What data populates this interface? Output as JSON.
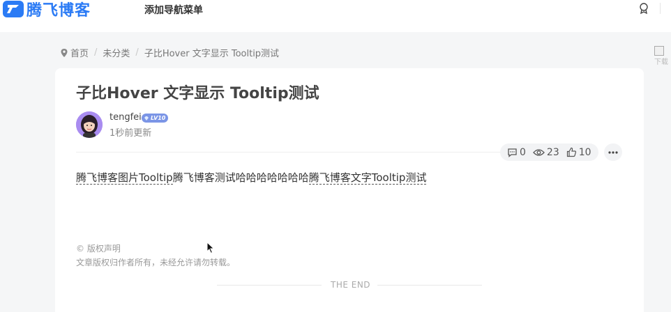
{
  "header": {
    "logo_text": "腾飞博客",
    "nav_add": "添加导航菜单",
    "user_icon": "award-icon"
  },
  "side": {
    "broken_image_alt": "下载"
  },
  "breadcrumb": {
    "home": "首页",
    "category": "未分类",
    "current": "子比Hover 文字显示 Tooltip测试"
  },
  "article": {
    "title": "子比Hover 文字显示 Tooltip测试",
    "author": {
      "name": "tengfei",
      "level": "LV10",
      "updated": "1秒前更新"
    },
    "stats": {
      "comments": "0",
      "views": "23",
      "likes": "10"
    },
    "content": {
      "part1": "腾飞博客图片Tooltip",
      "part2": "腾飞博客测试哈哈哈哈哈哈哈",
      "part3": "腾飞博客文字Tooltip测试"
    },
    "copyright": {
      "heading": "© 版权声明",
      "text": "文章版权归作者所有，未经允许请勿转载。"
    },
    "end_text": "THE END"
  },
  "colors": {
    "brand": "#2b7bf5",
    "badge": "#7b95e6",
    "avatar_bg": "#a98cf0"
  }
}
